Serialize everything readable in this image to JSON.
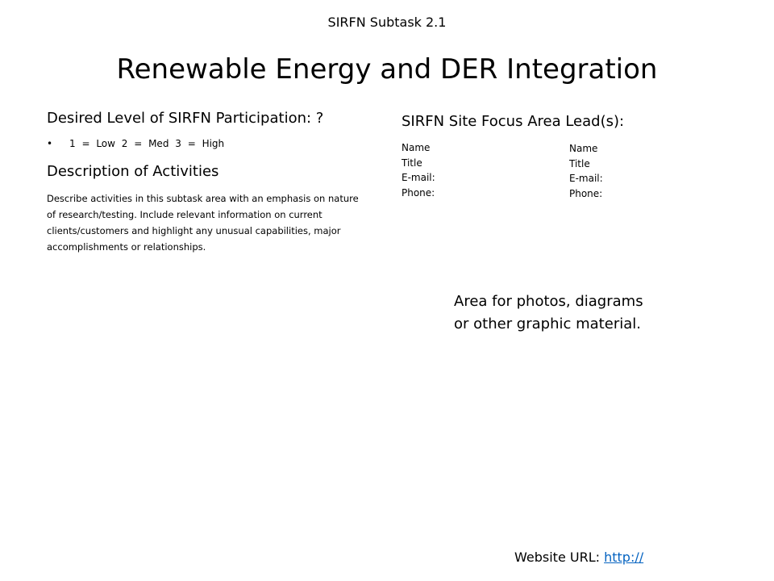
{
  "subtitle": "SIRFN Subtask 2.1",
  "title": "Renewable Energy and DER Integration",
  "participation": {
    "heading": "Desired Level of SIRFN Participation:  ?",
    "bullet": "•",
    "scale": "1 = Low   2 = Med   3 = High"
  },
  "description": {
    "heading": "Description of Activities",
    "body": "Describe activities in this subtask  area with an emphasis on nature of research/testing.  Include relevant information on current clients/customers and highlight any unusual capabilities, major accomplishments or relationships."
  },
  "leads": {
    "heading": "SIRFN Site Focus Area Lead(s):",
    "contacts": [
      {
        "name": "Name",
        "title": "Title",
        "email": "E-mail:",
        "phone": "Phone:"
      },
      {
        "name": "Name",
        "title": "Title",
        "email": "E-mail:",
        "phone": "Phone:"
      }
    ]
  },
  "graphic_area": {
    "line1": "Area for photos, diagrams",
    "line2": "or other graphic material."
  },
  "website": {
    "label": "Website  URL: ",
    "link": "http://"
  }
}
